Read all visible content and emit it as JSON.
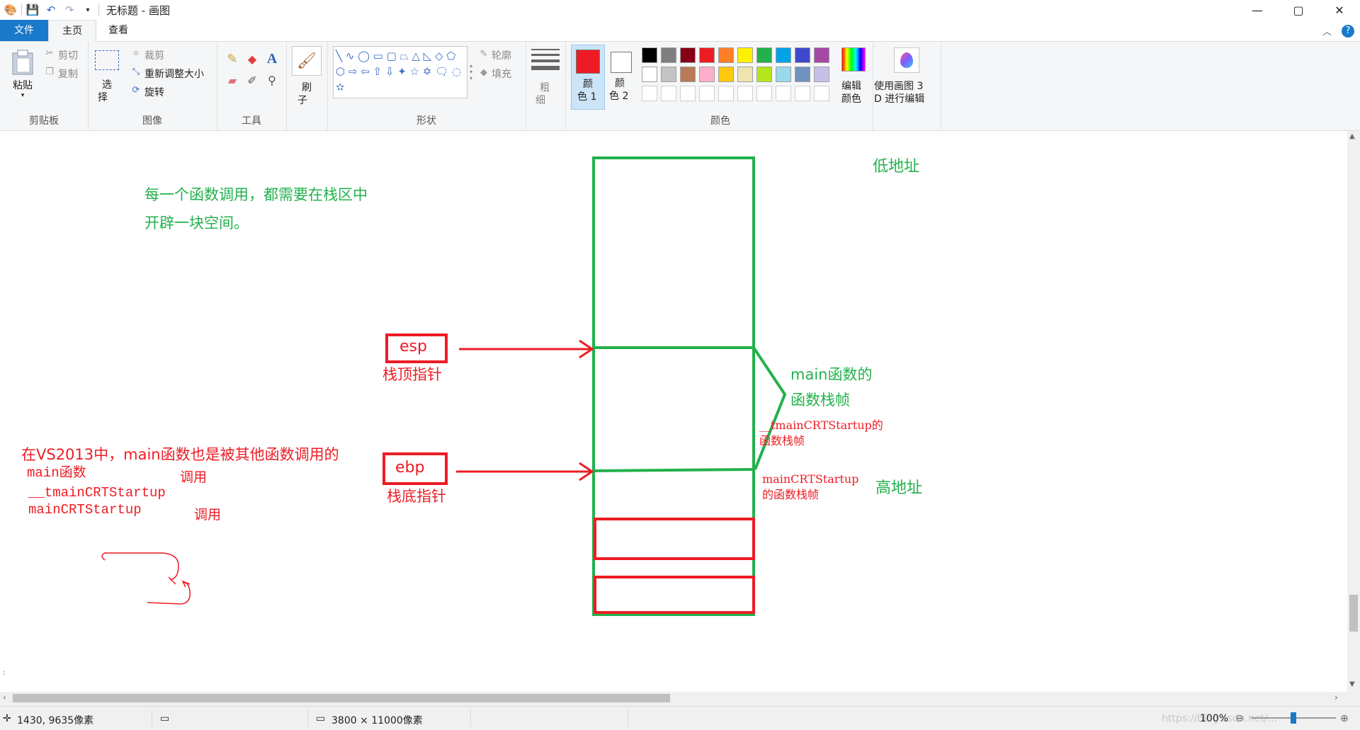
{
  "window": {
    "title": "无标题 - 画图",
    "controls": {
      "minimize": "—",
      "maximize": "▢",
      "close": "✕"
    }
  },
  "ribbon_tabs": [
    "文件",
    "主页",
    "查看"
  ],
  "ribbon": {
    "clipboard": {
      "paste": "粘贴",
      "cut": "剪切",
      "copy": "复制",
      "label": "剪贴板"
    },
    "image": {
      "select_1": "选",
      "select_2": "择",
      "crop": "裁剪",
      "resize": "重新调整大小",
      "rotate": "旋转",
      "label": "图像"
    },
    "tools": {
      "label": "工具"
    },
    "brushes": {
      "line1": "刷",
      "line2": "子"
    },
    "shapes": {
      "outline": "轮廓",
      "fill": "填充",
      "label": "形状"
    },
    "size": {
      "line1": "粗",
      "line2": "细"
    },
    "color1": {
      "line1": "颜",
      "line2": "色 1"
    },
    "color2": {
      "line1": "颜",
      "line2": "色 2"
    },
    "colors_label": "颜色",
    "edit_colors": {
      "line1": "编辑",
      "line2": "颜色"
    },
    "paint3d": {
      "line1": "使用画图 3",
      "line2": "D 进行编辑"
    },
    "palette_colors": [
      "#000000",
      "#7f7f7f",
      "#880015",
      "#ed1c24",
      "#ff7f27",
      "#fff200",
      "#22b14c",
      "#00a2e8",
      "#3f48cc",
      "#a349a4",
      "#ffffff",
      "#c3c3c3",
      "#b97a57",
      "#ffaec9",
      "#ffc90e",
      "#efe4b0",
      "#b5e61d",
      "#99d9ea",
      "#7092be",
      "#c8bfe7"
    ],
    "active_color1": "#ed1c24",
    "active_color2": "#ffffff"
  },
  "canvas": {
    "low_address": "低地址",
    "high_address": "高地址",
    "note_line1": "每一个函数调用，都需要在栈区中",
    "note_line2": "开辟一块空间。",
    "esp": "esp",
    "esp_label": "栈顶指针",
    "ebp": "ebp",
    "ebp_label": "栈底指针",
    "main_frame_line1": "main函数的",
    "main_frame_line2": "函数栈帧",
    "tmain_frame_line1": "__tmainCRTStartup的",
    "tmain_frame_line2": "函数栈帧",
    "maincrt_frame_line1": "mainCRTStartup",
    "maincrt_frame_line2": "的函数栈帧",
    "vs_note": "在VS2013中，main函数也是被其他函数调用的",
    "chain_main": "main函数",
    "chain_tmain": "__tmainCRTStartup",
    "chain_maincrt": "mainCRTStartup",
    "call1": "调用",
    "call2": "调用"
  },
  "statusbar": {
    "cursor_pos": "1430, 9635像素",
    "image_size": "3800 × 11000像素",
    "zoom": "100%",
    "watermark": "https://blog.csdn.net/..."
  }
}
